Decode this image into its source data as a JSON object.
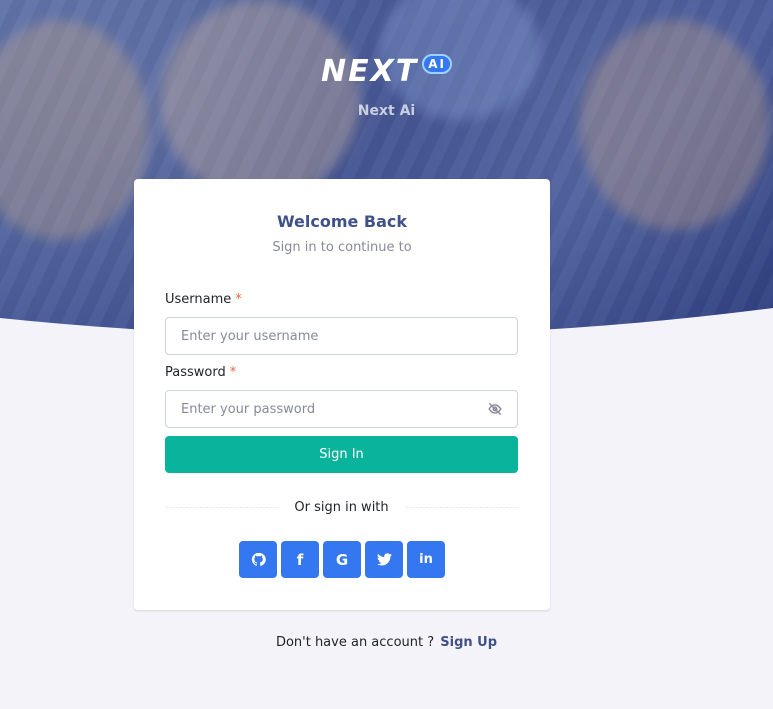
{
  "brand": {
    "logo_text": "NEXT",
    "logo_badge": "AI",
    "subtitle": "Next Ai"
  },
  "card": {
    "title": "Welcome Back",
    "subtitle": "Sign in to continue to",
    "username": {
      "label": "Username",
      "required_mark": "*",
      "placeholder": "Enter your username",
      "value": ""
    },
    "password": {
      "label": "Password",
      "required_mark": "*",
      "placeholder": "Enter your password",
      "value": ""
    },
    "signin_label": "Sign In",
    "divider_text": "Or sign in with",
    "socials": [
      {
        "icon": "github-icon",
        "glyph": ""
      },
      {
        "icon": "facebook-icon",
        "glyph": "f"
      },
      {
        "icon": "google-icon",
        "glyph": "G"
      },
      {
        "icon": "twitter-icon",
        "glyph": ""
      },
      {
        "icon": "linkedin-icon",
        "glyph": "in"
      }
    ]
  },
  "footer": {
    "prompt": "Don't have an account ?",
    "link": "Sign Up"
  },
  "colors": {
    "primary": "#405189",
    "success": "#0ab39c",
    "social": "#3577f1",
    "danger": "#f06548",
    "background": "#f3f3f9"
  }
}
